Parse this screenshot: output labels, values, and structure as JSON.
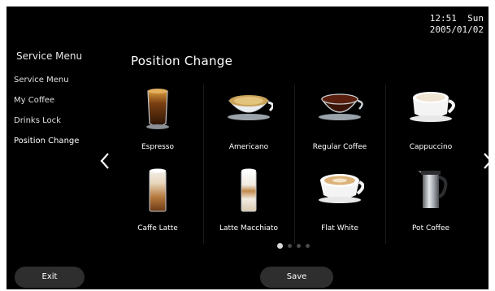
{
  "status": {
    "time_line": "12:51  Sun",
    "date_line": "2005/01/02"
  },
  "sidebar": {
    "title": "Service Menu",
    "items": [
      {
        "label": "Service Menu"
      },
      {
        "label": "My Coffee"
      },
      {
        "label": "Drinks Lock"
      },
      {
        "label": "Position Change"
      }
    ]
  },
  "main": {
    "title": "Position Change",
    "drinks": [
      {
        "label": "Espresso",
        "icon": "espresso-glass-icon"
      },
      {
        "label": "Americano",
        "icon": "americano-cup-icon"
      },
      {
        "label": "Regular Coffee",
        "icon": "regular-coffee-cup-icon"
      },
      {
        "label": "Cappuccino",
        "icon": "cappuccino-cup-icon"
      },
      {
        "label": "Caffe Latte",
        "icon": "latte-glass-icon"
      },
      {
        "label": "Latte Macchiato",
        "icon": "latte-macchiato-glass-icon"
      },
      {
        "label": "Flat White",
        "icon": "flat-white-cup-icon"
      },
      {
        "label": "Pot Coffee",
        "icon": "coffee-pot-icon"
      }
    ],
    "pager": {
      "pages": 4,
      "current": 1
    }
  },
  "footer": {
    "exit_label": "Exit",
    "save_label": "Save"
  }
}
